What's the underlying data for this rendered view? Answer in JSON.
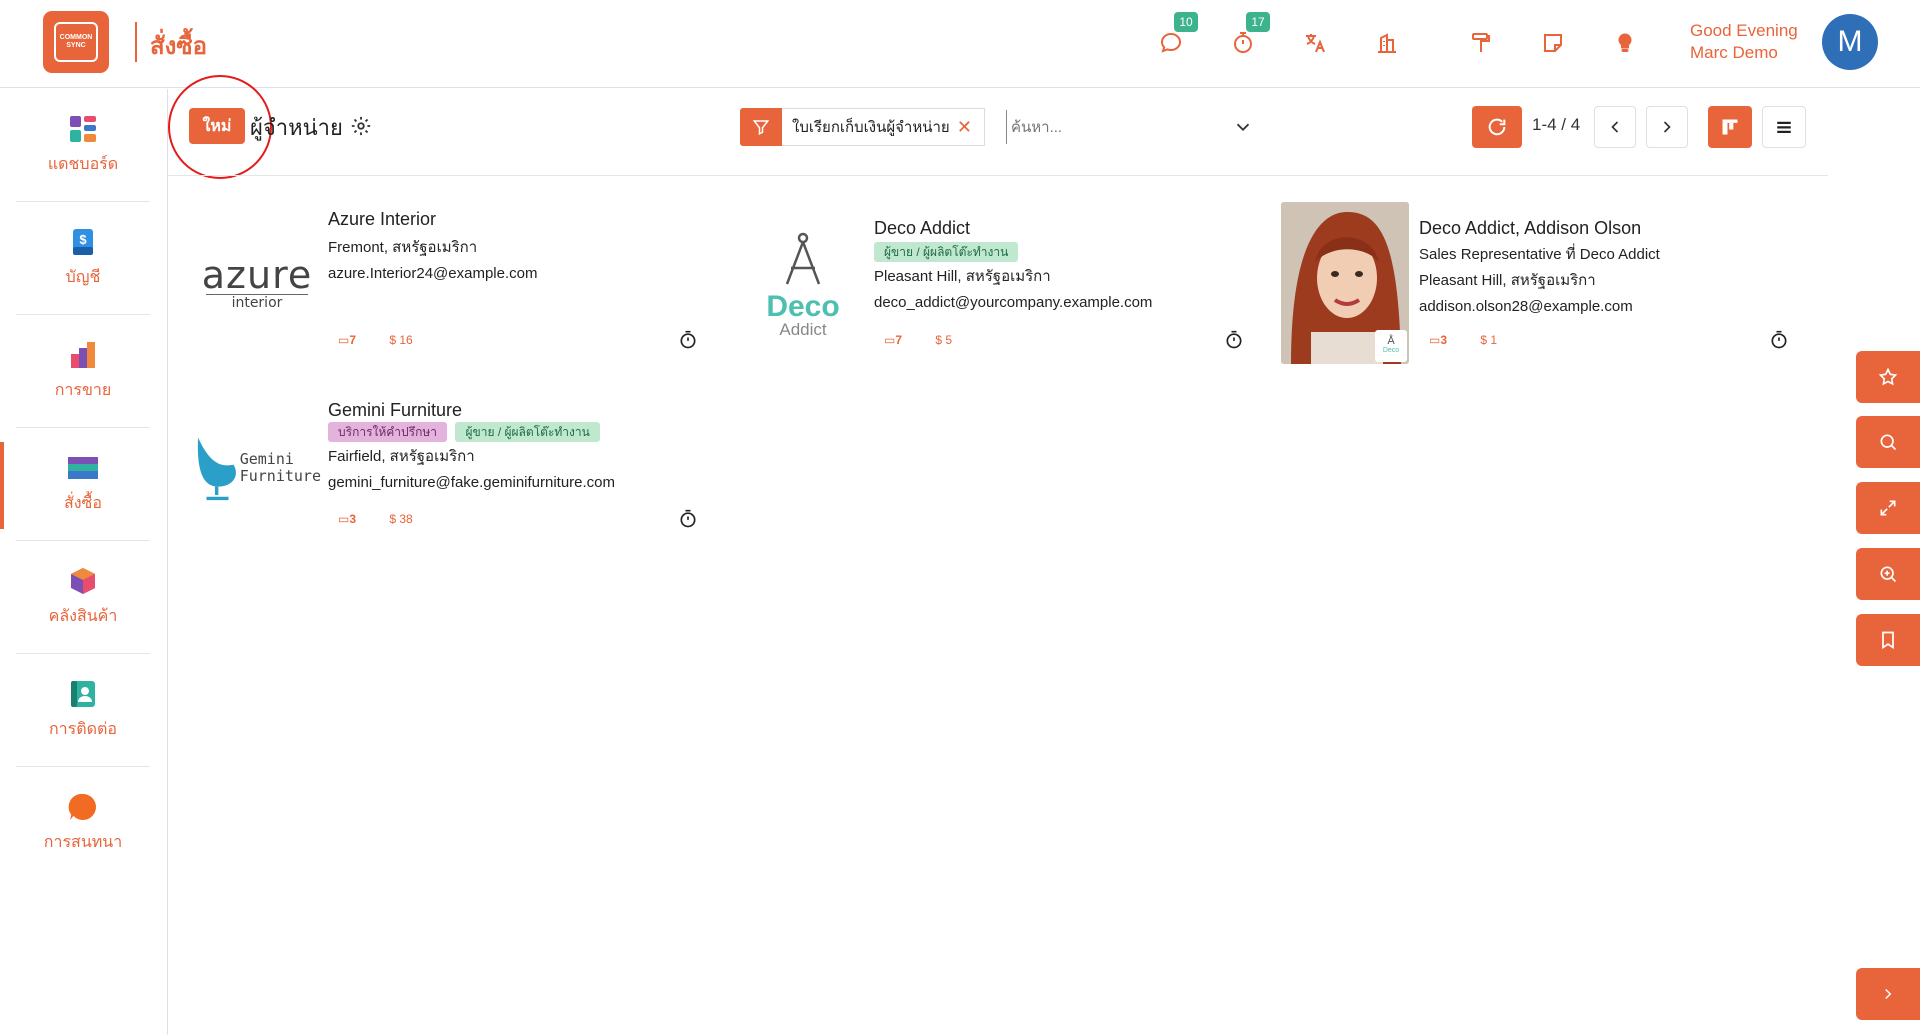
{
  "header": {
    "logo_text": "COMMON SYNC",
    "app_title": "สั่งซื้อ",
    "messages_badge": "10",
    "activities_badge": "17",
    "greeting_line1": "Good Evening",
    "greeting_line2": "Marc Demo",
    "avatar_initial": "M"
  },
  "sidebar": {
    "items": [
      {
        "label": "แดชบอร์ด",
        "icon": "dashboard-icon"
      },
      {
        "label": "บัญชี",
        "icon": "accounting-icon"
      },
      {
        "label": "การขาย",
        "icon": "sales-icon"
      },
      {
        "label": "สั่งซื้อ",
        "icon": "purchase-icon"
      },
      {
        "label": "คลังสินค้า",
        "icon": "inventory-icon"
      },
      {
        "label": "การติดต่อ",
        "icon": "contacts-icon"
      },
      {
        "label": "การสนทนา",
        "icon": "discuss-icon"
      }
    ],
    "active_index": 3
  },
  "control": {
    "new_label": "ใหม่",
    "breadcrumb": "ผู้จำหน่าย",
    "facet_label": "ใบเรียกเก็บเงินผู้จำหน่าย",
    "search_placeholder": "ค้นหา...",
    "pager": "1-4 / 4"
  },
  "cards": [
    {
      "name": "Azure Interior",
      "tags": [],
      "lines": [
        "Fremont, สหรัฐอเมริกา",
        "azure.Interior24@example.com"
      ],
      "stat1": "7",
      "stat2": "$ 16",
      "logo_main": "azure",
      "logo_sub": "interior"
    },
    {
      "name": "Deco Addict",
      "tags": [
        {
          "label": "ผู้ขาย / ผู้ผลิตโต๊ะทำงาน",
          "color": "green"
        }
      ],
      "lines": [
        "Pleasant Hill, สหรัฐอเมริกา",
        "deco_addict@yourcompany.example.com"
      ],
      "stat1": "7",
      "stat2": "$ 5",
      "logo_main": "Deco",
      "logo_sub": "Addict"
    },
    {
      "name": "Deco Addict, Addison Olson",
      "tags": [],
      "lines": [
        "Sales Representative ที่ Deco Addict",
        "Pleasant Hill, สหรัฐอเมริกา",
        "addison.olson28@example.com"
      ],
      "stat1": "3",
      "stat2": "$ 1",
      "mini_logo": "Deco"
    },
    {
      "name": "Gemini Furniture",
      "tags": [
        {
          "label": "บริการให้คำปรึกษา",
          "color": "purple"
        },
        {
          "label": "ผู้ขาย / ผู้ผลิตโต๊ะทำงาน",
          "color": "green"
        }
      ],
      "lines": [
        "Fairfield, สหรัฐอเมริกา",
        "gemini_furniture@fake.geminifurniture.com"
      ],
      "stat1": "3",
      "stat2": "$ 38",
      "logo_main": "Gemini",
      "logo_sub": "Furniture"
    }
  ]
}
